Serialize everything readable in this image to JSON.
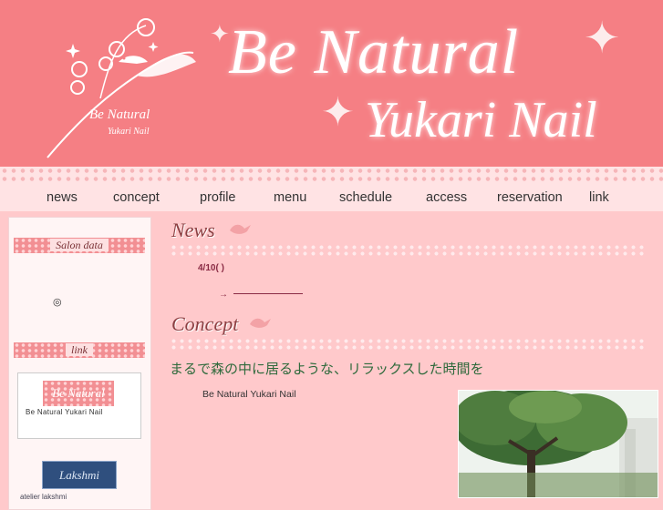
{
  "header": {
    "brand_line1": "Be Natural",
    "brand_line2": "Yukari Nail",
    "logo_line1": "Be Natural",
    "logo_line2": "Yukari Nail"
  },
  "nav": [
    "news",
    "concept",
    "profile",
    "menu",
    "schedule",
    "access",
    "reservation",
    "link"
  ],
  "sidebar": {
    "salon_title": "Salon data",
    "salon_mark": "◎",
    "link_title": "link",
    "link_banner": "Be Natural",
    "link_caption": "Be  Natural  Yukari  Nail",
    "lakshmi_banner": "Lakshmi",
    "lakshmi_under": "atelier lakshmi"
  },
  "news": {
    "heading": "News",
    "date": "4/10(  )",
    "arrow": "→"
  },
  "concept": {
    "heading": "Concept",
    "tagline": "まるで森の中に居るような、リラックスした時間を",
    "body": "Be Natural Yukari Nail"
  },
  "colors": {
    "header": "#f57f84",
    "page": "#ffc9cb",
    "accent": "#8a2b44",
    "green": "#2f6a3c"
  }
}
